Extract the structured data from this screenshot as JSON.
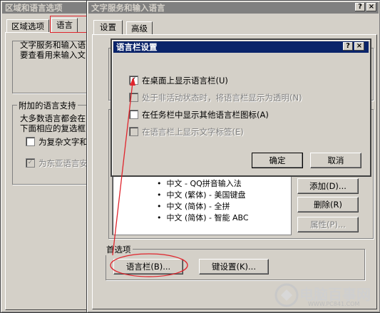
{
  "region_window": {
    "title": "区域和语言选项",
    "tabs": [
      "区域选项",
      "语言"
    ],
    "group1_lines": [
      "文字服务和输入语",
      "要查看用来输入文"
    ],
    "group2_title": "附加的语言支持",
    "group2_lines": [
      "大多数语言都会在",
      "下面相应的复选框"
    ],
    "check_complex": "为复杂文字和",
    "check_east_asian": "为东亚语言安"
  },
  "text_services_window": {
    "title": "文字服务和输入语言",
    "tabs": [
      "设置",
      "高级"
    ],
    "installed_items": [
      "中文 - QQ拼音输入法",
      "中文 (繁体) - 美国键盘",
      "中文 (简体) - 全拼",
      "中文 (简体) - 智能 ABC"
    ],
    "add_button": "添加(D)...",
    "remove_button": "删除(R)",
    "properties_button": "属性(P)...",
    "preferences_label": "首选项",
    "language_bar_button": "语言栏(B)...",
    "key_settings_button": "键设置(K)..."
  },
  "language_bar_dialog": {
    "title": "语言栏设置",
    "options": [
      {
        "label": "在桌面上显示语言栏(U)",
        "checked": true,
        "enabled": true
      },
      {
        "label": "处于非活动状态时，将语言栏显示为透明(N)",
        "checked": false,
        "enabled": false
      },
      {
        "label": "在任务栏中显示其他语言栏图标(A)",
        "checked": false,
        "enabled": true
      },
      {
        "label": "在语言栏上显示文字标签(E)",
        "checked": false,
        "enabled": false
      }
    ],
    "ok_button": "确定",
    "cancel_button": "取消"
  },
  "titlebar_buttons": {
    "help": "?",
    "close": "×"
  },
  "watermark": {
    "brand": "电脑百事网",
    "url": "WWW.PC841.COM"
  },
  "colors": {
    "annotation_red": "#e0242c",
    "active_title": "#0a246a",
    "face": "#d4d0c8"
  }
}
